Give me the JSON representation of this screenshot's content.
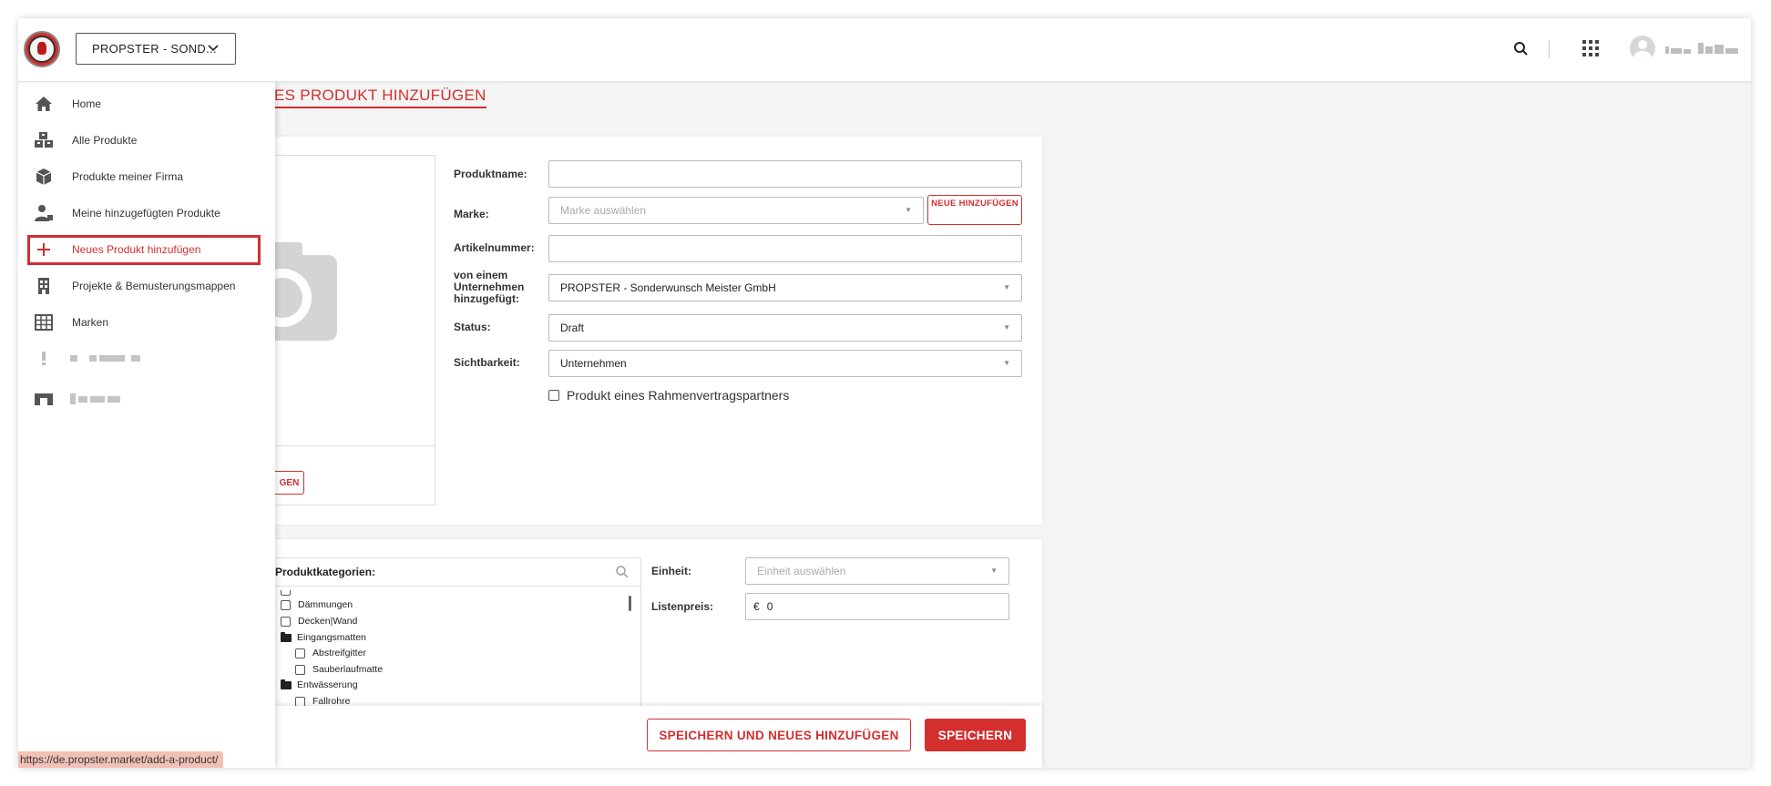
{
  "header": {
    "company_select": "PROPSTER - SOND...",
    "accent_color": "#d32f2f"
  },
  "sidebar": {
    "items": [
      {
        "label": "Home",
        "icon": "home-icon"
      },
      {
        "label": "Alle Produkte",
        "icon": "boxes-icon"
      },
      {
        "label": "Produkte meiner Firma",
        "icon": "box-icon"
      },
      {
        "label": "Meine hinzugefügten Produkte",
        "icon": "user-icon"
      },
      {
        "label": "Neues Produkt hinzufügen",
        "icon": "plus-icon",
        "active": true
      },
      {
        "label": "Projekte & Bemusterungsmappen",
        "icon": "building-icon"
      },
      {
        "label": "Marken",
        "icon": "grid-icon"
      }
    ]
  },
  "page": {
    "title": "ES PRODUKT HINZUFÜGEN"
  },
  "form": {
    "upload_button": "GEN",
    "produktname_label": "Produktname:",
    "produktname_value": "",
    "marke_label": "Marke:",
    "marke_placeholder": "Marke auswählen",
    "neue_button": "NEUE HINZUFÜGEN",
    "artikelnummer_label": "Artikelnummer:",
    "artikelnummer_value": "",
    "unternehmen_label": "von einem Unternehmen hinzugefügt:",
    "unternehmen_value": "PROPSTER - Sonderwunsch Meister GmbH",
    "status_label": "Status:",
    "status_value": "Draft",
    "sichtbarkeit_label": "Sichtbarkeit:",
    "sichtbarkeit_value": "Unternehmen",
    "rahmenvertrag_label": "Produkt eines Rahmenvertragspartners"
  },
  "categories": {
    "header": "Produktkategorien:",
    "items": [
      {
        "label": "Dämmungen",
        "type": "checkbox",
        "level": 0
      },
      {
        "label": "Decken|Wand",
        "type": "checkbox",
        "level": 0
      },
      {
        "label": "Eingangsmatten",
        "type": "folder",
        "level": 0
      },
      {
        "label": "Abstreifgitter",
        "type": "checkbox",
        "level": 1
      },
      {
        "label": "Sauberlaufmatte",
        "type": "checkbox",
        "level": 1
      },
      {
        "label": "Entwässerung",
        "type": "folder",
        "level": 0
      },
      {
        "label": "Fallrohre",
        "type": "checkbox",
        "level": 1
      }
    ]
  },
  "pricing": {
    "einheit_label": "Einheit:",
    "einheit_placeholder": "Einheit auswählen",
    "listenpreis_label": "Listenpreis:",
    "currency": "€",
    "listenpreis_value": "0"
  },
  "actions": {
    "save_and_new": "SPEICHERN UND NEUES HINZUFÜGEN",
    "save": "SPEICHERN"
  },
  "status_bar": {
    "url": "https://de.propster.market/add-a-product/"
  }
}
